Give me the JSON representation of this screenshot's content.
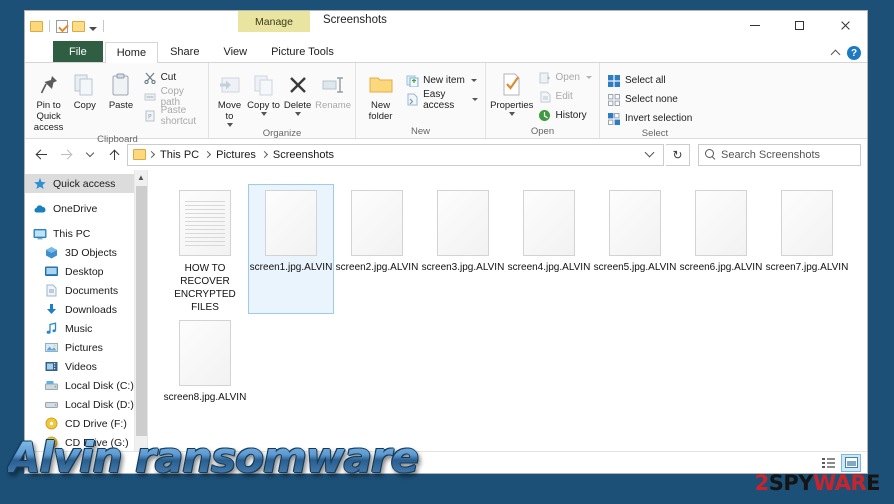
{
  "window": {
    "title": "Screenshots",
    "contextual_tab": "Manage",
    "minimize_label": "Minimize",
    "maximize_label": "Maximize",
    "close_label": "Close"
  },
  "quick_access_toolbar": {
    "items": [
      "folder-icon",
      "properties-icon",
      "new-folder-icon",
      "customize-caret"
    ]
  },
  "tabs": [
    {
      "label": "File",
      "id": "file"
    },
    {
      "label": "Home",
      "id": "home"
    },
    {
      "label": "Share",
      "id": "share"
    },
    {
      "label": "View",
      "id": "view"
    },
    {
      "label": "Picture Tools",
      "id": "picture-tools"
    }
  ],
  "help": {
    "collapse_label": "^",
    "help_label": "?"
  },
  "ribbon": {
    "groups": [
      {
        "name": "Clipboard",
        "title": "Clipboard",
        "big_buttons": [
          {
            "label": "Pin to Quick access",
            "icon": "pin-icon"
          },
          {
            "label": "Copy",
            "icon": "copy-icon"
          },
          {
            "label": "Paste",
            "icon": "paste-icon"
          }
        ],
        "small_buttons": [
          {
            "label": "Cut",
            "icon": "scissors-icon",
            "disabled": false
          },
          {
            "label": "Copy path",
            "icon": "copy-path-icon",
            "disabled": true
          },
          {
            "label": "Paste shortcut",
            "icon": "paste-shortcut-icon",
            "disabled": true
          }
        ]
      },
      {
        "name": "Organize",
        "title": "Organize",
        "big_buttons": [
          {
            "label": "Move to",
            "icon": "move-to-icon",
            "dropdown": true,
            "disabled": true
          },
          {
            "label": "Copy to",
            "icon": "copy-to-icon",
            "dropdown": true,
            "disabled": true
          },
          {
            "label": "Delete",
            "icon": "delete-icon",
            "dropdown": true
          },
          {
            "label": "Rename",
            "icon": "rename-icon",
            "disabled": true
          }
        ]
      },
      {
        "name": "New",
        "title": "New",
        "big_buttons": [
          {
            "label": "New folder",
            "icon": "new-folder-icon"
          }
        ],
        "small_buttons": [
          {
            "label": "New item",
            "icon": "new-item-icon",
            "dropdown": true
          },
          {
            "label": "Easy access",
            "icon": "easy-access-icon",
            "dropdown": true
          }
        ]
      },
      {
        "name": "Open",
        "title": "Open",
        "big_buttons": [
          {
            "label": "Properties",
            "icon": "properties-icon",
            "dropdown": true
          }
        ],
        "small_buttons": [
          {
            "label": "Open",
            "icon": "open-icon",
            "dropdown": true,
            "disabled": true
          },
          {
            "label": "Edit",
            "icon": "edit-icon",
            "disabled": true
          },
          {
            "label": "History",
            "icon": "history-icon"
          }
        ]
      },
      {
        "name": "Select",
        "title": "Select",
        "small_buttons": [
          {
            "label": "Select all",
            "icon": "select-all-icon"
          },
          {
            "label": "Select none",
            "icon": "select-none-icon"
          },
          {
            "label": "Invert selection",
            "icon": "invert-selection-icon"
          }
        ]
      }
    ]
  },
  "address_bar": {
    "back_label": "Back",
    "forward_label": "Forward",
    "recent_label": "Recent locations",
    "up_label": "Up",
    "breadcrumbs": [
      "This PC",
      "Pictures",
      "Screenshots"
    ],
    "refresh_label": "Refresh"
  },
  "search": {
    "placeholder": "Search Screenshots"
  },
  "nav_pane": {
    "items": [
      {
        "label": "Quick access",
        "icon": "star-icon",
        "indent": 0,
        "selected": true
      },
      {
        "label": "OneDrive",
        "icon": "onedrive-cloud-icon",
        "indent": 0,
        "gap": true
      },
      {
        "label": "This PC",
        "icon": "this-pc-icon",
        "indent": 0,
        "gap": true
      },
      {
        "label": "3D Objects",
        "icon": "3d-objects-icon",
        "indent": 1
      },
      {
        "label": "Desktop",
        "icon": "desktop-icon",
        "indent": 1
      },
      {
        "label": "Documents",
        "icon": "documents-icon",
        "indent": 1
      },
      {
        "label": "Downloads",
        "icon": "downloads-icon",
        "indent": 1
      },
      {
        "label": "Music",
        "icon": "music-icon",
        "indent": 1
      },
      {
        "label": "Pictures",
        "icon": "pictures-icon",
        "indent": 1
      },
      {
        "label": "Videos",
        "icon": "videos-icon",
        "indent": 1
      },
      {
        "label": "Local Disk (C:)",
        "icon": "system-drive-icon",
        "indent": 1
      },
      {
        "label": "Local Disk (D:)",
        "icon": "drive-icon",
        "indent": 1
      },
      {
        "label": "CD Drive (F:)",
        "icon": "cd-drive-icon",
        "indent": 1
      },
      {
        "label": "CD Drive (G:)",
        "icon": "cd-drive-icon",
        "indent": 1
      }
    ]
  },
  "files": [
    {
      "name": "HOW TO RECOVER ENCRYPTED FILES",
      "icon": "text-document-icon",
      "selected": false
    },
    {
      "name": "screen1.jpg.ALVIN",
      "icon": "blank-file-icon",
      "selected": true
    },
    {
      "name": "screen2.jpg.ALVIN",
      "icon": "blank-file-icon",
      "selected": false
    },
    {
      "name": "screen3.jpg.ALVIN",
      "icon": "blank-file-icon",
      "selected": false
    },
    {
      "name": "screen4.jpg.ALVIN",
      "icon": "blank-file-icon",
      "selected": false
    },
    {
      "name": "screen5.jpg.ALVIN",
      "icon": "blank-file-icon",
      "selected": false
    },
    {
      "name": "screen6.jpg.ALVIN",
      "icon": "blank-file-icon",
      "selected": false
    },
    {
      "name": "screen7.jpg.ALVIN",
      "icon": "blank-file-icon",
      "selected": false
    },
    {
      "name": "screen8.jpg.ALVIN",
      "icon": "blank-file-icon",
      "selected": false
    }
  ],
  "status_bar": {
    "details_view_label": "Details view",
    "large_icons_view_label": "Large icons view",
    "active_view": "large-icons"
  },
  "watermarks": {
    "title": "Alvin ransomware",
    "brand": {
      "part1": "2",
      "part2": "SPY",
      "part3": "WAR",
      "part4": "E"
    }
  },
  "colors": {
    "desktop_background": "#1d5077",
    "file_tab": "#2f5e43",
    "contextual_tab": "#e9e4a0",
    "selection": "#eaf4fc",
    "selection_border": "#9ccbec",
    "brand_red": "#c9242c",
    "watermark_blue": "#5d9ad1"
  }
}
